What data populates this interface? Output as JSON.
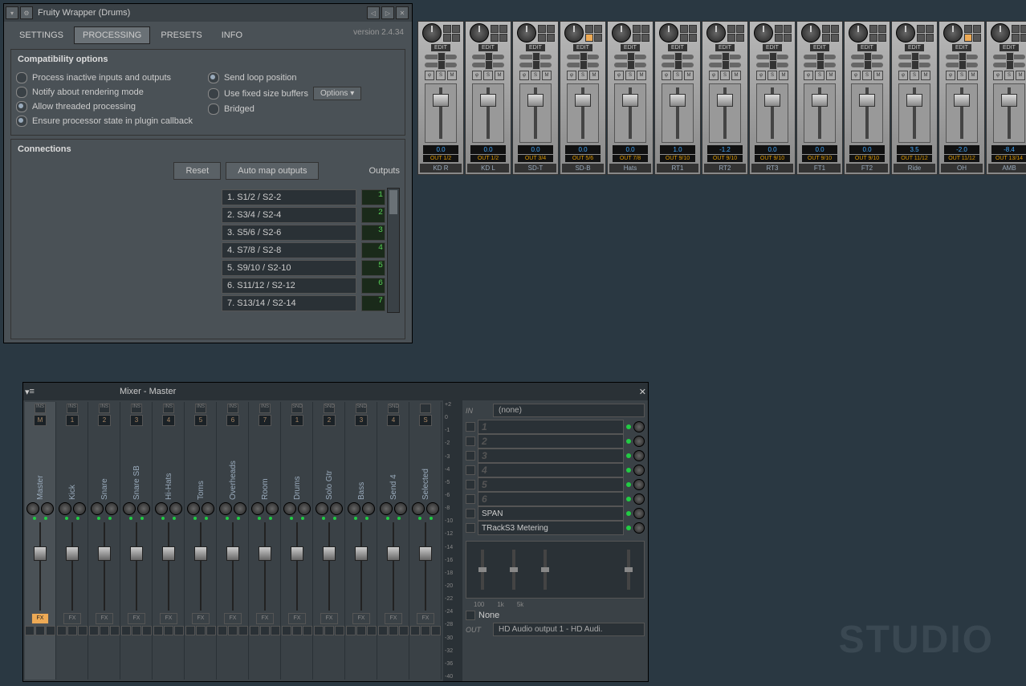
{
  "wrapper": {
    "title": "Fruity Wrapper (Drums)",
    "version": "version 2.4.34",
    "tabs": {
      "settings": "SETTINGS",
      "processing": "PROCESSING",
      "presets": "PRESETS",
      "info": "INFO"
    },
    "compat": {
      "title": "Compatibility options",
      "process_inactive": "Process inactive inputs and outputs",
      "notify_render": "Notify about rendering mode",
      "allow_threaded": "Allow threaded processing",
      "ensure_state": "Ensure processor state in plugin callback",
      "send_loop": "Send loop position",
      "fixed_buffers": "Use fixed size buffers",
      "bridged": "Bridged",
      "options_btn": "Options ▾"
    },
    "connections": {
      "title": "Connections",
      "reset": "Reset",
      "automap": "Auto map outputs",
      "outputs_label": "Outputs",
      "rows": [
        {
          "label": "1. S1/2 / S2-2",
          "num": "1"
        },
        {
          "label": "2. S3/4 / S2-4",
          "num": "2"
        },
        {
          "label": "3. S5/6 / S2-6",
          "num": "3"
        },
        {
          "label": "4. S7/8 / S2-8",
          "num": "4"
        },
        {
          "label": "5. S9/10 / S2-10",
          "num": "5"
        },
        {
          "label": "6. S11/12 / S2-12",
          "num": "6"
        },
        {
          "label": "7. S13/14 / S2-14",
          "num": "7"
        }
      ]
    }
  },
  "drum_channels": [
    {
      "val": "0.0",
      "out": "OUT 1/2",
      "name": "KD R",
      "hl": false
    },
    {
      "val": "0.0",
      "out": "OUT 1/2",
      "name": "KD L",
      "hl": false
    },
    {
      "val": "0.0",
      "out": "OUT 3/4",
      "name": "SD-T",
      "hl": false
    },
    {
      "val": "0.0",
      "out": "OUT 5/6",
      "name": "SD-B",
      "hl": true
    },
    {
      "val": "0.0",
      "out": "OUT 7/8",
      "name": "Hats",
      "hl": false
    },
    {
      "val": "1.0",
      "out": "OUT 9/10",
      "name": "RT1",
      "hl": false
    },
    {
      "val": "-1.2",
      "out": "OUT 9/10",
      "name": "RT2",
      "hl": false
    },
    {
      "val": "0.0",
      "out": "OUT 9/10",
      "name": "RT3",
      "hl": false
    },
    {
      "val": "0.0",
      "out": "OUT 9/10",
      "name": "FT1",
      "hl": false
    },
    {
      "val": "0.0",
      "out": "OUT 9/10",
      "name": "FT2",
      "hl": false
    },
    {
      "val": "3.5",
      "out": "OUT 11/12",
      "name": "Ride",
      "hl": false
    },
    {
      "val": "-2.0",
      "out": "OUT 11/12",
      "name": "OH",
      "hl": true
    },
    {
      "val": "-8.4",
      "out": "OUT 13/14",
      "name": "AMB",
      "hl": false
    }
  ],
  "mixer": {
    "title": "Mixer - Master",
    "input_label": "IN",
    "output_label": "OUT",
    "none": "(none)",
    "out_device": "HD Audio output 1 - HD Audi.",
    "none_fx": "None",
    "eq_labels": {
      "lo": "100",
      "mid": "1k",
      "hi": "5k"
    },
    "scale": [
      "+2",
      "0",
      "-1",
      "-2",
      "-3",
      "-4",
      "-5",
      "-6",
      "-8",
      "-10",
      "-12",
      "-14",
      "-16",
      "-18",
      "-20",
      "-22",
      "-24",
      "-28",
      "-30",
      "-32",
      "-36",
      "-40"
    ],
    "headers": {
      "ins": "INS",
      "snd": "SND"
    },
    "tracks": [
      {
        "label": "Master",
        "idx": "M",
        "hdr": "ins"
      },
      {
        "label": "Kick",
        "idx": "1",
        "hdr": "ins"
      },
      {
        "label": "Snare",
        "idx": "2",
        "hdr": "ins"
      },
      {
        "label": "Snare SB",
        "idx": "3",
        "hdr": "ins"
      },
      {
        "label": "Hi-Hats",
        "idx": "4",
        "hdr": "ins"
      },
      {
        "label": "Toms",
        "idx": "5",
        "hdr": "ins"
      },
      {
        "label": "Overheads",
        "idx": "6",
        "hdr": "ins"
      },
      {
        "label": "Room",
        "idx": "7",
        "hdr": "ins"
      },
      {
        "label": "Drums",
        "idx": "1",
        "hdr": "snd"
      },
      {
        "label": "Solo Gtr",
        "idx": "2",
        "hdr": "snd"
      },
      {
        "label": "Bass",
        "idx": "3",
        "hdr": "snd"
      },
      {
        "label": "Send 4",
        "idx": "4",
        "hdr": "snd"
      },
      {
        "label": "Selected",
        "idx": "S",
        "hdr": ""
      }
    ],
    "slots": [
      {
        "name": "",
        "num": "1"
      },
      {
        "name": "",
        "num": "2"
      },
      {
        "name": "",
        "num": "3"
      },
      {
        "name": "",
        "num": "4"
      },
      {
        "name": "",
        "num": "5"
      },
      {
        "name": "",
        "num": "6"
      },
      {
        "name": "SPAN",
        "num": ""
      },
      {
        "name": "TRackS3 Metering",
        "num": ""
      }
    ],
    "fx_label": "FX",
    "edit_label": "EDIT"
  },
  "watermark": "STUDIO"
}
